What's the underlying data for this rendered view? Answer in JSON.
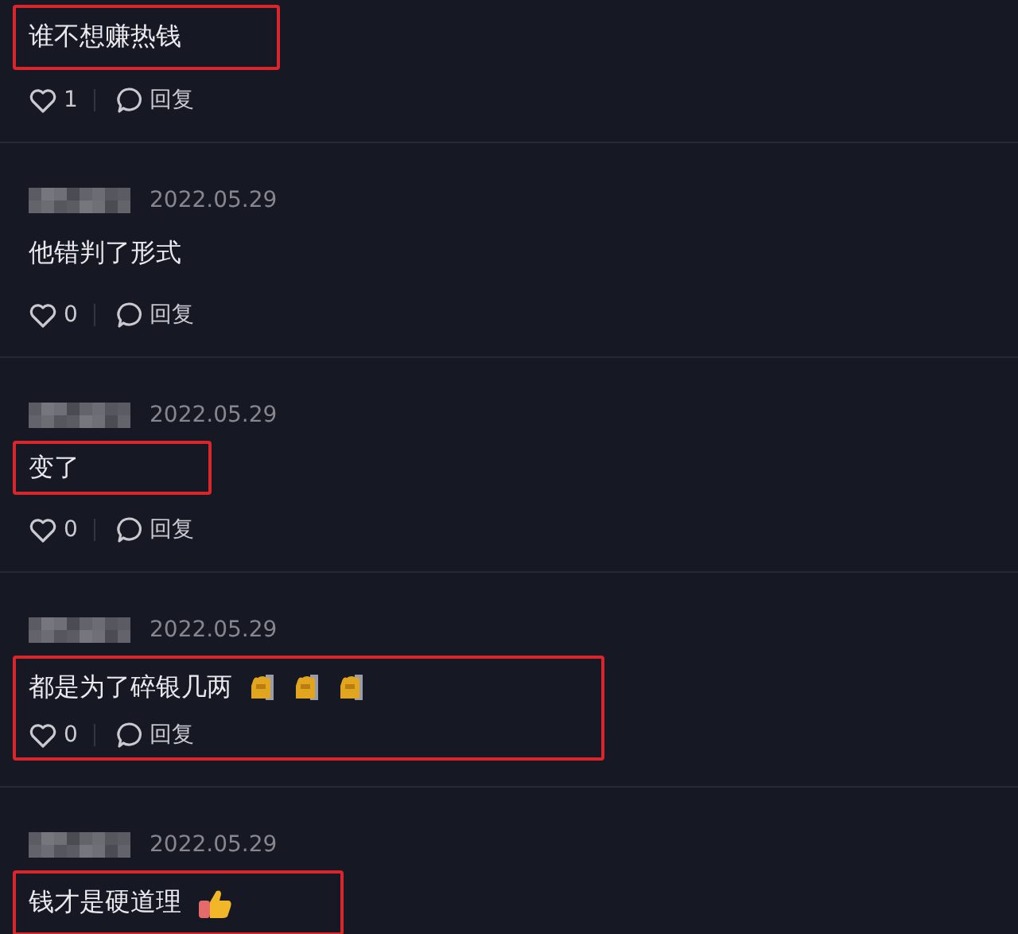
{
  "comments": [
    {
      "text": "谁不想赚热钱",
      "likes": "1",
      "reply": "回复",
      "highlighted": true
    },
    {
      "date": "2022.05.29",
      "text": "他错判了形式",
      "likes": "0",
      "reply": "回复",
      "highlighted": false
    },
    {
      "date": "2022.05.29",
      "text": "变了",
      "likes": "0",
      "reply": "回复",
      "highlighted": true
    },
    {
      "date": "2022.05.29",
      "text": "都是为了碎银几两",
      "emojis": [
        {
          "kind": "figure"
        },
        {
          "kind": "figure"
        },
        {
          "kind": "figure"
        }
      ],
      "likes": "0",
      "reply": "回复",
      "highlighted": true,
      "highlight_includes_actions": true
    },
    {
      "date": "2022.05.29",
      "text": "钱才是硬道理",
      "emojis": [
        {
          "kind": "thumbs-up"
        }
      ],
      "highlighted": true
    }
  ]
}
